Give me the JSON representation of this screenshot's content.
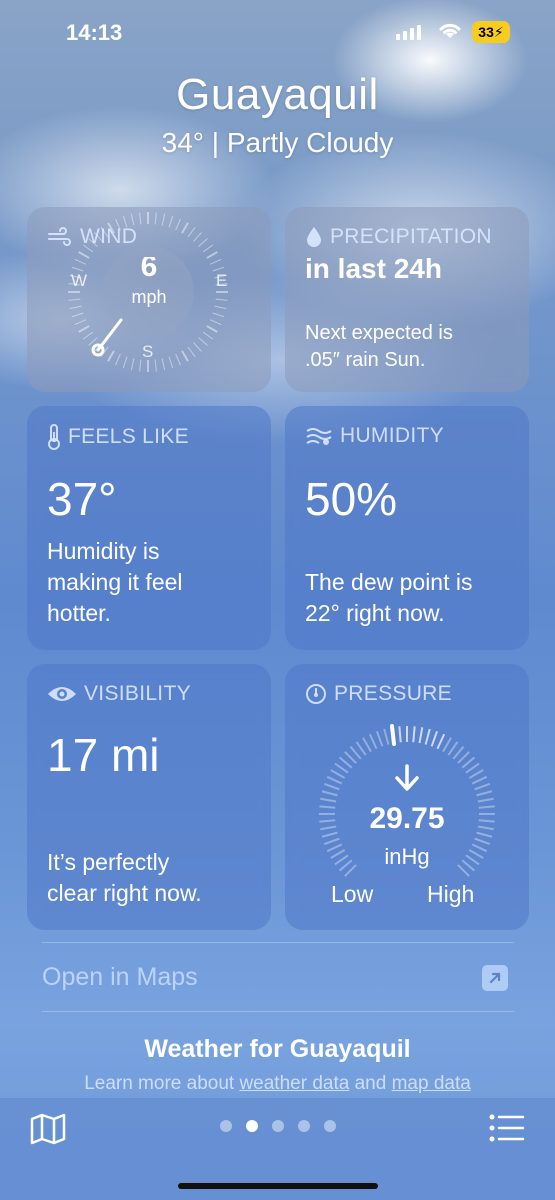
{
  "status": {
    "time": "14:13",
    "battery": "33"
  },
  "header": {
    "city": "Guayaquil",
    "temp": "34°",
    "condition": "Partly Cloudy"
  },
  "wind": {
    "title": "WIND",
    "speed": "6",
    "unit": "mph",
    "compass": {
      "w": "W",
      "e": "E",
      "s": "S"
    }
  },
  "precipitation": {
    "title": "PRECIPITATION",
    "headline": "in last 24h",
    "desc_line1": "Next expected is",
    "desc_line2": ".05″ rain Sun."
  },
  "feels_like": {
    "title": "FEELS LIKE",
    "value": "37°",
    "desc_line1": "Humidity is",
    "desc_line2": "making it feel",
    "desc_line3": "hotter."
  },
  "humidity": {
    "title": "HUMIDITY",
    "value": "50%",
    "desc_line1": "The dew point is",
    "desc_line2": "22° right now."
  },
  "visibility": {
    "title": "VISIBILITY",
    "value": "17 mi",
    "desc_line1": "It’s perfectly",
    "desc_line2": "clear right now."
  },
  "pressure": {
    "title": "PRESSURE",
    "value": "29.75",
    "unit": "inHg",
    "low": "Low",
    "high": "High",
    "trend": "falling"
  },
  "maps": {
    "label": "Open in Maps"
  },
  "footer": {
    "title": "Weather for Guayaquil",
    "text_prefix": "Learn more about ",
    "link1": "weather data",
    "text_mid": " and ",
    "link2": "map data"
  },
  "tabbar": {
    "page_count": 5,
    "active_index": 1
  },
  "colors": {
    "accent": "#f5cc1f",
    "card": "#5b83c9",
    "background": "#6f94cc"
  }
}
